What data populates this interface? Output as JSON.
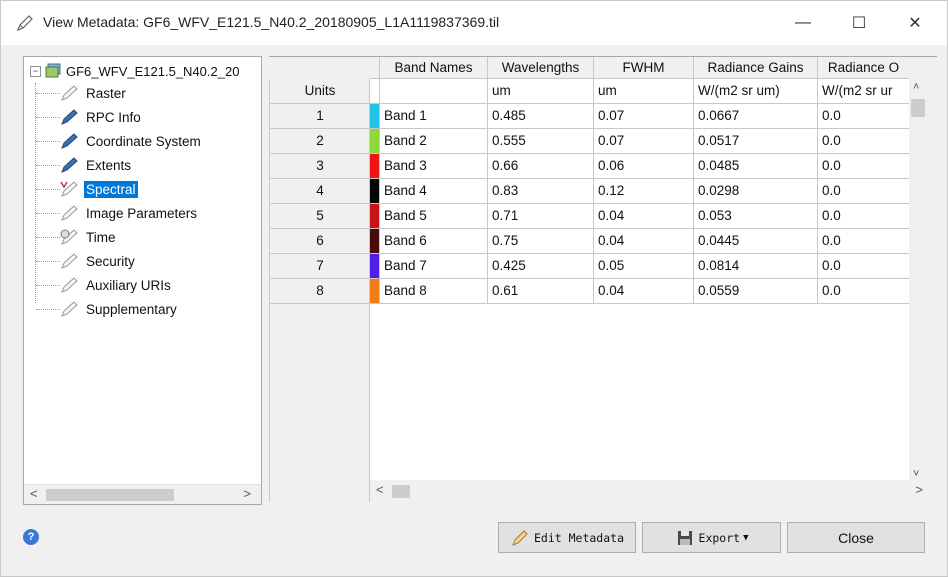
{
  "window": {
    "title": "View Metadata: GF6_WFV_E121.5_N40.2_20180905_L1A1119837369.til",
    "minimize": "—",
    "maximize": "☐",
    "close": "✕"
  },
  "tree": {
    "root_expander": "−",
    "root_label": "GF6_WFV_E121.5_N40.2_20",
    "items": [
      {
        "label": "Raster"
      },
      {
        "label": "RPC Info"
      },
      {
        "label": "Coordinate System"
      },
      {
        "label": "Extents"
      },
      {
        "label": "Spectral"
      },
      {
        "label": "Image Parameters"
      },
      {
        "label": "Time"
      },
      {
        "label": "Security"
      },
      {
        "label": "Auxiliary URIs"
      },
      {
        "label": "Supplementary"
      }
    ],
    "selected": "Spectral",
    "scroll_left": "<",
    "scroll_right": ">"
  },
  "table": {
    "headers": [
      "Band Names",
      "Wavelengths",
      "FWHM",
      "Radiance Gains",
      "Radiance O"
    ],
    "units_label": "Units",
    "units_row": [
      "",
      "um",
      "um",
      "W/(m2 sr um)",
      "W/(m2 sr ur"
    ],
    "rows": [
      {
        "num": "1",
        "color": "#22c3e6",
        "band": "Band 1",
        "wavelength": "0.485",
        "fwhm": "0.07",
        "gain": "0.0667",
        "offset": "0.0"
      },
      {
        "num": "2",
        "color": "#8fd83a",
        "band": "Band 2",
        "wavelength": "0.555",
        "fwhm": "0.07",
        "gain": "0.0517",
        "offset": "0.0"
      },
      {
        "num": "3",
        "color": "#f21313",
        "band": "Band 3",
        "wavelength": "0.66",
        "fwhm": "0.06",
        "gain": "0.0485",
        "offset": "0.0"
      },
      {
        "num": "4",
        "color": "#050505",
        "band": "Band 4",
        "wavelength": "0.83",
        "fwhm": "0.12",
        "gain": "0.0298",
        "offset": "0.0"
      },
      {
        "num": "5",
        "color": "#c81414",
        "band": "Band 5",
        "wavelength": "0.71",
        "fwhm": "0.04",
        "gain": "0.053",
        "offset": "0.0"
      },
      {
        "num": "6",
        "color": "#4a0a0a",
        "band": "Band 6",
        "wavelength": "0.75",
        "fwhm": "0.04",
        "gain": "0.0445",
        "offset": "0.0"
      },
      {
        "num": "7",
        "color": "#4f1ee8",
        "band": "Band 7",
        "wavelength": "0.425",
        "fwhm": "0.05",
        "gain": "0.0814",
        "offset": "0.0"
      },
      {
        "num": "8",
        "color": "#f07c17",
        "band": "Band 8",
        "wavelength": "0.61",
        "fwhm": "0.04",
        "gain": "0.0559",
        "offset": "0.0"
      }
    ],
    "scroll_up": "˄",
    "scroll_down": "˅",
    "scroll_left": "<",
    "scroll_right": ">"
  },
  "footer": {
    "help": "?",
    "edit_label": "Edit Metadata",
    "export_label": "Export",
    "export_caret": "▼",
    "close_label": "Close"
  },
  "icons": {
    "title": "pencil-icon",
    "tree_root": "image-stack-icon",
    "tree_item": "metadata-pencil-icon",
    "edit": "pencil-icon",
    "export": "floppy-disk-icon",
    "help": "question-icon"
  },
  "colors": {
    "selection": "#0078d7",
    "help": "#3a78d8"
  }
}
